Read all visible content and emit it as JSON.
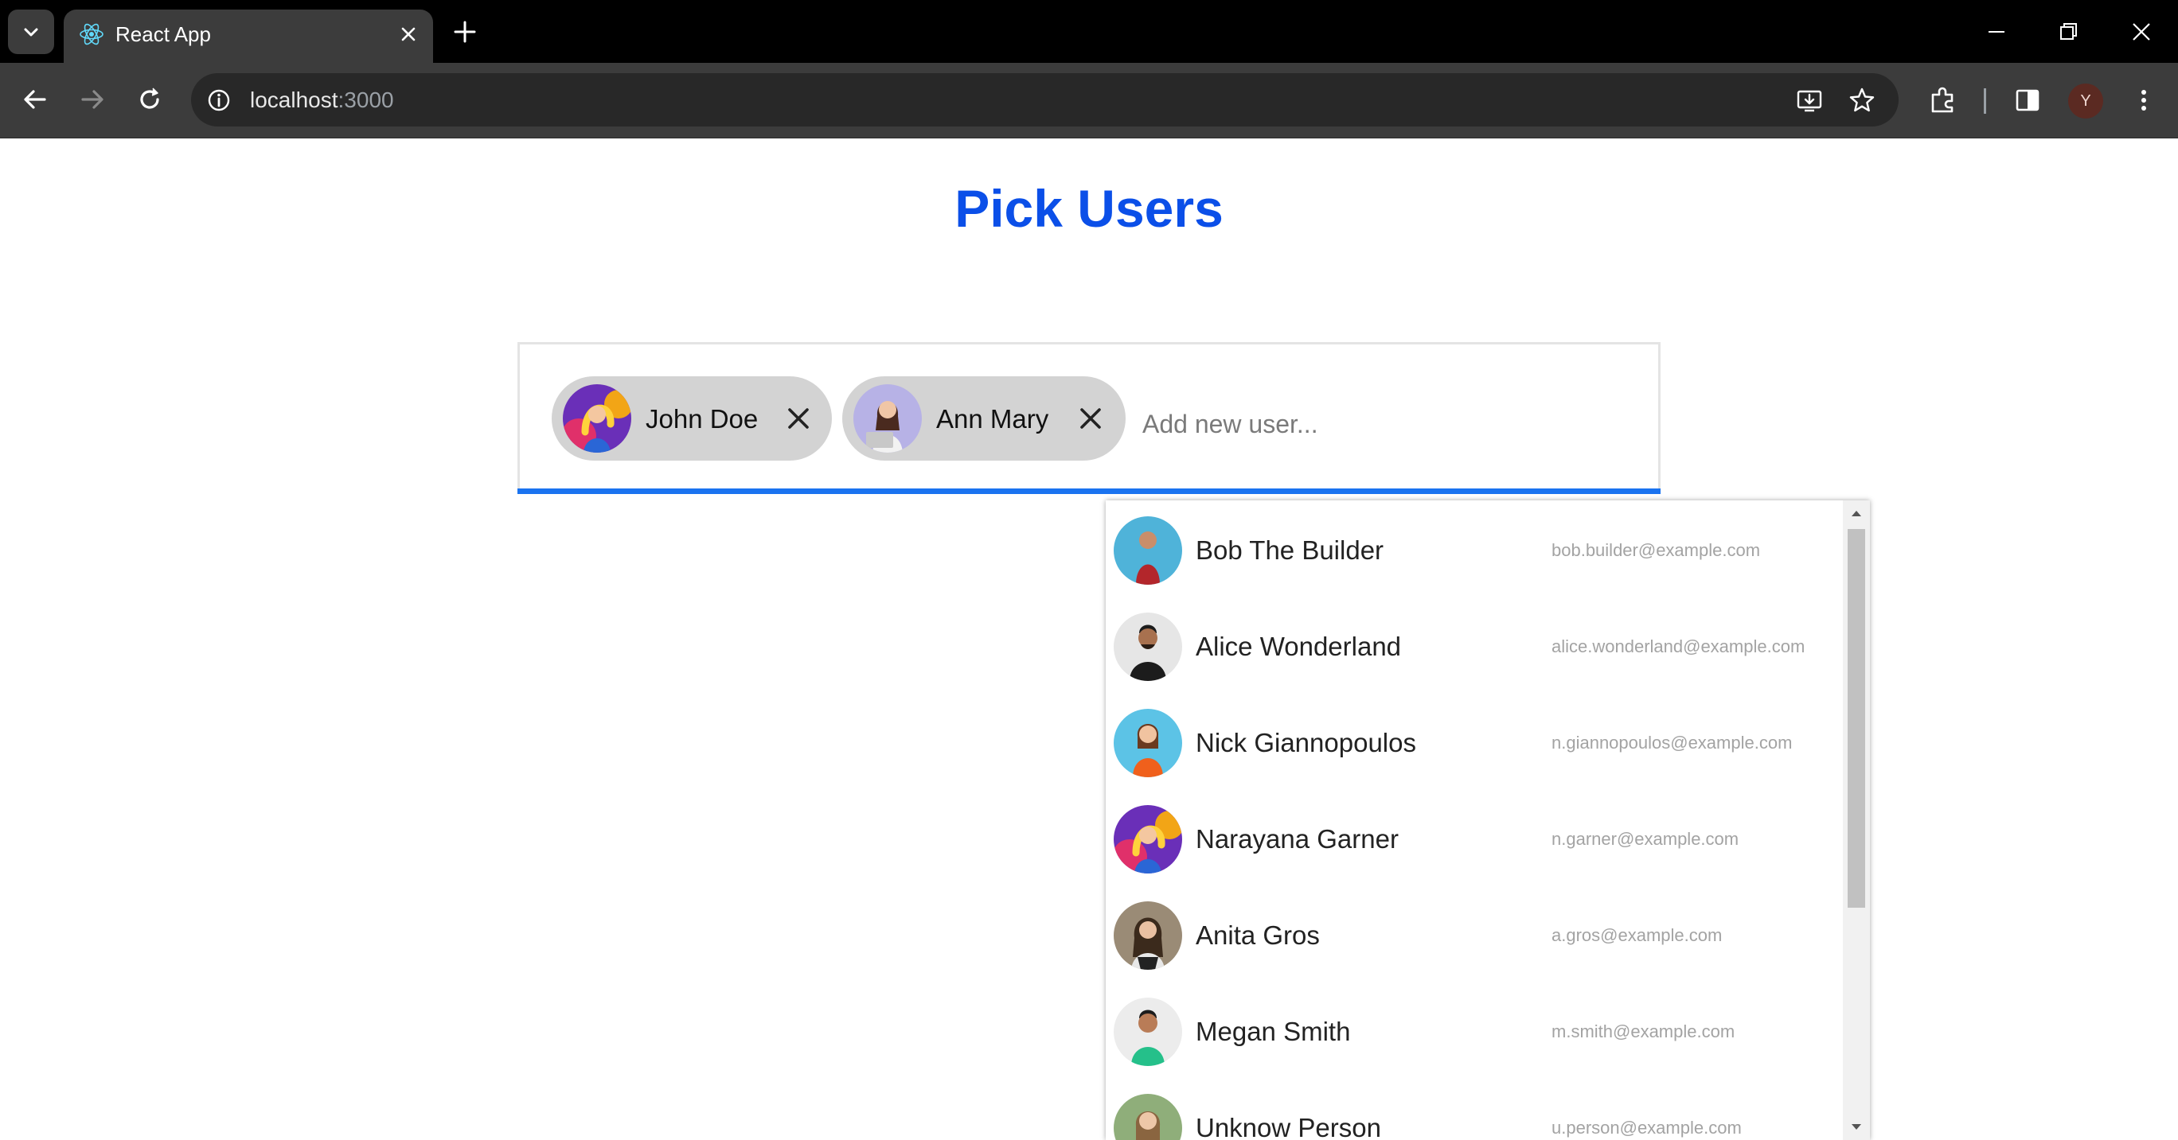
{
  "browser": {
    "tab_title": "React App",
    "url_host": "localhost",
    "url_port": ":3000",
    "profile_initial": "Y"
  },
  "page": {
    "title": "Pick Users"
  },
  "picker": {
    "chips": [
      {
        "name": "John Doe",
        "avatar": "avatar-purple-illustration"
      },
      {
        "name": "Ann Mary",
        "avatar": "avatar-woman-laptop"
      }
    ],
    "input_placeholder": "Add new user..."
  },
  "dropdown": {
    "items": [
      {
        "name": "Bob The Builder",
        "email": "bob.builder@example.com"
      },
      {
        "name": "Alice Wonderland",
        "email": "alice.wonderland@example.com"
      },
      {
        "name": "Nick Giannopoulos",
        "email": "n.giannopoulos@example.com"
      },
      {
        "name": "Narayana Garner",
        "email": "n.garner@example.com"
      },
      {
        "name": "Anita Gros",
        "email": "a.gros@example.com"
      },
      {
        "name": "Megan Smith",
        "email": "m.smith@example.com"
      },
      {
        "name": "Unknow Person",
        "email": "u.person@example.com"
      }
    ]
  },
  "colors": {
    "title_blue": "#0b4fe8",
    "underline_blue": "#1a73f0",
    "chip_gray": "#d3d3d3",
    "chrome_dark": "#3c3c3c"
  }
}
